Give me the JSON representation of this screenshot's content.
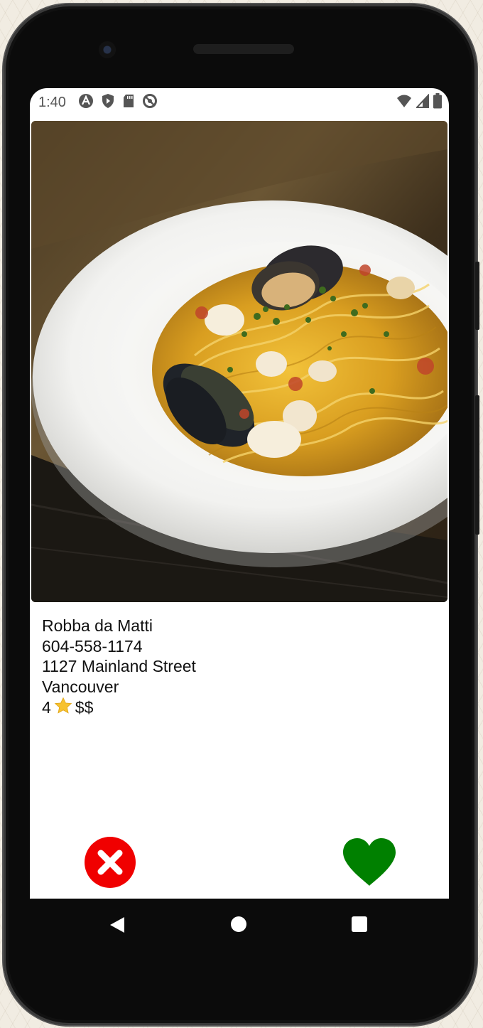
{
  "status_bar": {
    "time": "1:40",
    "left_icons": [
      "app-a-icon",
      "shield-icon",
      "sd-card-icon",
      "no-sync-icon"
    ],
    "right_icons": [
      "wifi-icon",
      "signal-icon",
      "battery-icon"
    ]
  },
  "restaurant": {
    "photo": "seafood-pasta-photo",
    "name": "Robba da Matti",
    "phone": "604-558-1174",
    "address": "1127 Mainland Street",
    "city": "Vancouver",
    "rating": "4",
    "rating_icon": "star-icon",
    "price": "$$"
  },
  "actions": {
    "reject_icon": "close-circle-icon",
    "like_icon": "heart-icon",
    "reject_color": "#f00000",
    "like_color": "#008000"
  },
  "nav_bar": {
    "items": [
      "back",
      "home",
      "recents"
    ]
  }
}
